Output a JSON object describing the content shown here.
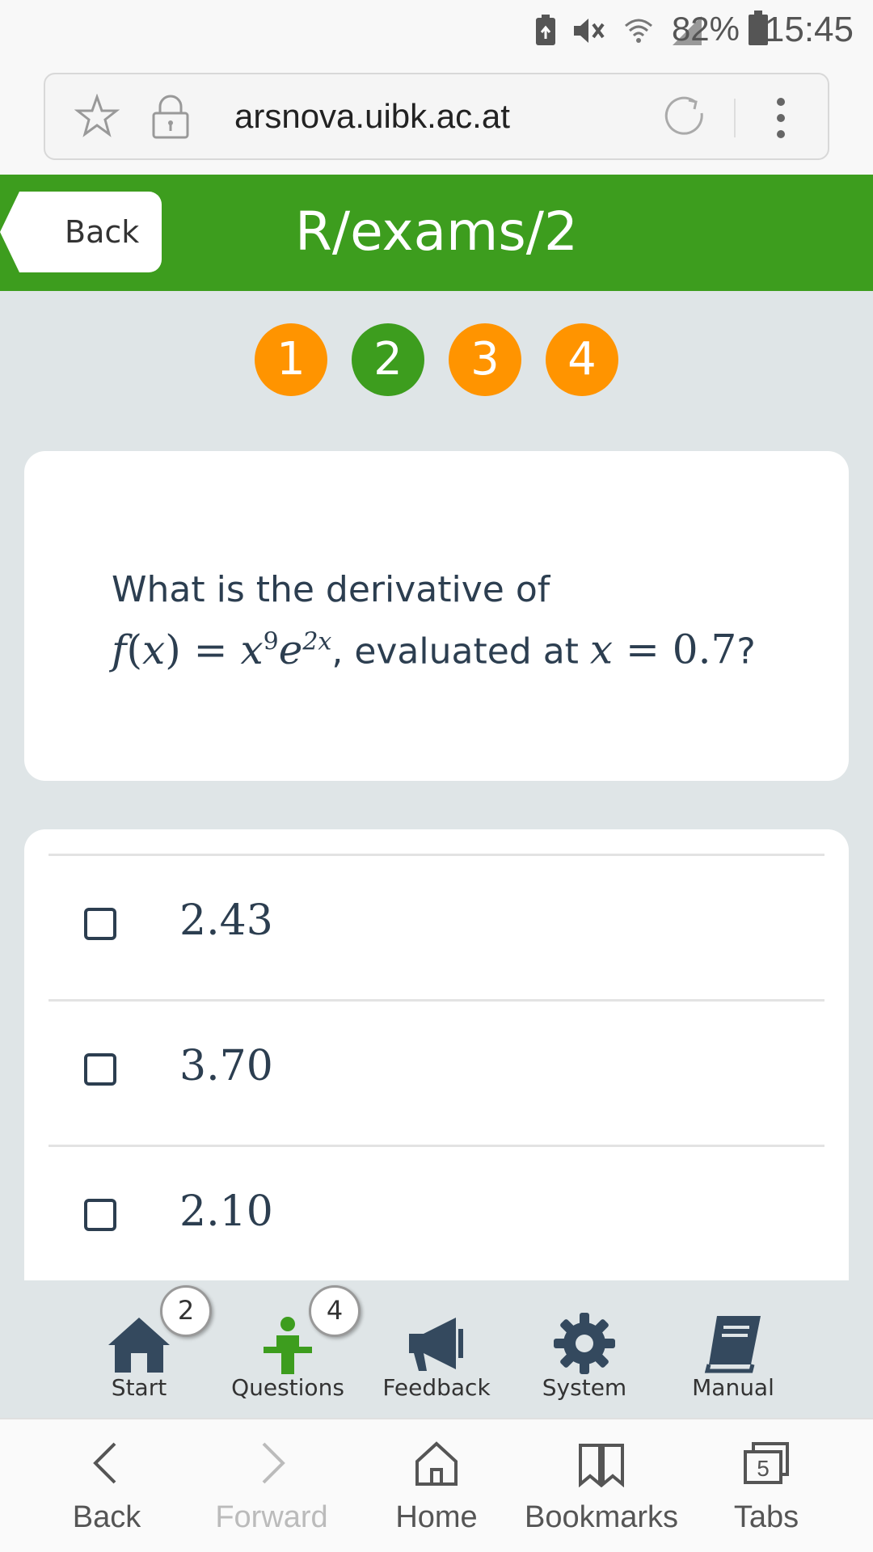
{
  "status_bar": {
    "battery_percent": "82%",
    "time": "15:45",
    "icons": [
      "battery-saver-icon",
      "mute-icon",
      "wifi-icon",
      "signal-icon",
      "battery-icon"
    ]
  },
  "browser": {
    "url": "arsnova.uibk.ac.at",
    "icons": [
      "star-icon",
      "lock-icon",
      "reload-icon",
      "more-vert-icon"
    ]
  },
  "header": {
    "back_label": "Back",
    "title": "R/exams/2"
  },
  "pager": {
    "pages": [
      {
        "label": "1",
        "state": "unanswered",
        "color": "#ff9400"
      },
      {
        "label": "2",
        "state": "current",
        "color": "#3d9d1e"
      },
      {
        "label": "3",
        "state": "unanswered",
        "color": "#ff9400"
      },
      {
        "label": "4",
        "state": "unanswered",
        "color": "#ff9400"
      }
    ]
  },
  "question": {
    "line1": "What is the derivative of",
    "func_f": "f",
    "func_x": "x",
    "func_base": "x",
    "func_pow": "9",
    "func_e": "e",
    "func_epow": "2x",
    "mid_text": ", evaluated at ",
    "eval_var": "x",
    "eval_val": "0.7",
    "end": "?"
  },
  "answers": [
    {
      "label": "2.43",
      "checked": false
    },
    {
      "label": "3.70",
      "checked": false
    },
    {
      "label": "2.10",
      "checked": false
    }
  ],
  "tabbar": {
    "items": [
      {
        "label": "Start",
        "icon": "home-icon",
        "badge": "2"
      },
      {
        "label": "Questions",
        "icon": "presenter-icon",
        "badge": "4"
      },
      {
        "label": "Feedback",
        "icon": "megaphone-icon"
      },
      {
        "label": "System",
        "icon": "gear-icon"
      },
      {
        "label": "Manual",
        "icon": "book-icon"
      }
    ],
    "active_color": "#3d9d1e"
  },
  "browser_nav": {
    "items": [
      {
        "label": "Back",
        "icon": "chevron-left-icon",
        "enabled": true
      },
      {
        "label": "Forward",
        "icon": "chevron-right-icon",
        "enabled": false
      },
      {
        "label": "Home",
        "icon": "home-outline-icon",
        "enabled": true
      },
      {
        "label": "Bookmarks",
        "icon": "bookmarks-icon",
        "enabled": true
      },
      {
        "label": "Tabs",
        "icon": "tabs-icon",
        "enabled": true,
        "count": "5"
      }
    ]
  },
  "colors": {
    "brand_green": "#3d9d1e",
    "accent_orange": "#ff9400",
    "background": "#dfe5e7",
    "text_dark": "#2c3e50"
  }
}
